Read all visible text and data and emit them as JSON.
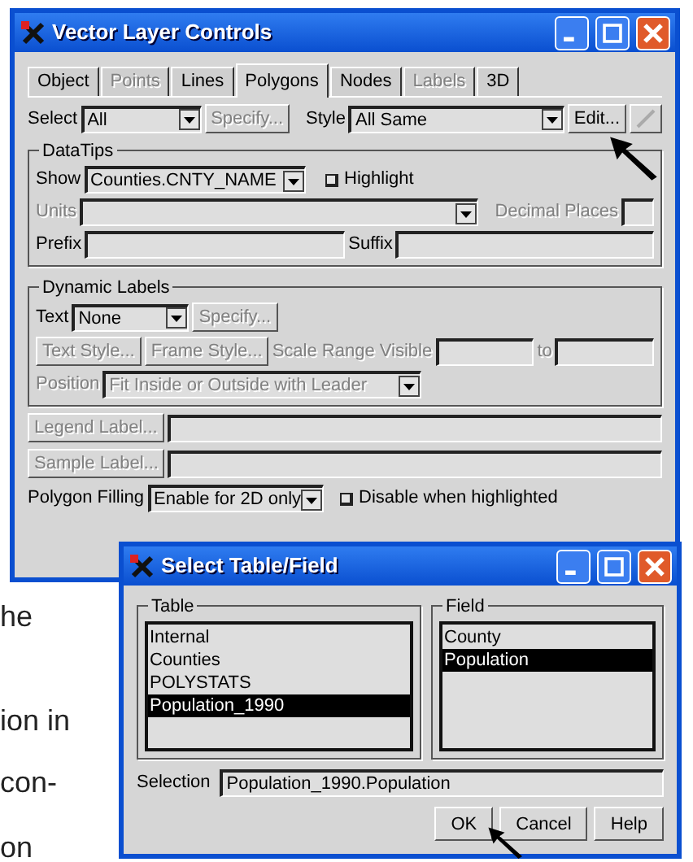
{
  "background_text": [
    "he",
    "ion in",
    "con-",
    "on"
  ],
  "main_window": {
    "title": "Vector Layer Controls",
    "tabs": [
      {
        "label": "Object",
        "selected": false,
        "disabled": false
      },
      {
        "label": "Points",
        "selected": false,
        "disabled": true
      },
      {
        "label": "Lines",
        "selected": false,
        "disabled": false
      },
      {
        "label": "Polygons",
        "selected": true,
        "disabled": false
      },
      {
        "label": "Nodes",
        "selected": false,
        "disabled": false
      },
      {
        "label": "Labels",
        "selected": false,
        "disabled": true
      },
      {
        "label": "3D",
        "selected": false,
        "disabled": false
      }
    ],
    "select": {
      "label": "Select",
      "value": "All",
      "button": {
        "label": "Specify...",
        "disabled": true
      }
    },
    "style": {
      "label": "Style",
      "value": "All Same",
      "button": {
        "label": "Edit...",
        "disabled": false
      }
    },
    "datatips": {
      "title": "DataTips",
      "show": {
        "label": "Show",
        "value": "Counties.CNTY_NAME"
      },
      "highlight": {
        "label": "Highlight",
        "checked": false
      },
      "units": {
        "label": "Units",
        "disabled": true
      },
      "decimal_places": {
        "label": "Decimal Places",
        "disabled": true
      },
      "prefix": {
        "label": "Prefix",
        "disabled": false
      },
      "suffix": {
        "label": "Suffix",
        "disabled": false
      }
    },
    "dynamic_labels": {
      "title": "Dynamic Labels",
      "text": {
        "label": "Text",
        "value": "None"
      },
      "specify_button": {
        "label": "Specify...",
        "disabled": true
      },
      "text_style_button": {
        "label": "Text Style...",
        "disabled": true
      },
      "frame_style_button": {
        "label": "Frame Style...",
        "disabled": true
      },
      "scale_range": {
        "label": "Scale Range Visible",
        "disabled": true
      },
      "to": {
        "label": "to",
        "disabled": true
      },
      "position": {
        "label": "Position",
        "value": "Fit Inside or Outside with Leader",
        "disabled": true
      }
    },
    "legend_label_button": {
      "label": "Legend Label...",
      "disabled": true
    },
    "sample_label_button": {
      "label": "Sample Label...",
      "disabled": true
    },
    "polygon_filling": {
      "label": "Polygon Filling",
      "value": "Enable for 2D only",
      "disable_when_highlighted": {
        "label": "Disable when highlighted",
        "checked": false
      }
    }
  },
  "dialog": {
    "title": "Select Table/Field",
    "table": {
      "title": "Table",
      "items": [
        {
          "label": "Internal",
          "selected": false
        },
        {
          "label": "Counties",
          "selected": false
        },
        {
          "label": "POLYSTATS",
          "selected": false
        },
        {
          "label": "Population_1990",
          "selected": true
        }
      ]
    },
    "field": {
      "title": "Field",
      "items": [
        {
          "label": "County",
          "selected": false
        },
        {
          "label": "Population",
          "selected": true
        }
      ]
    },
    "selection": {
      "label": "Selection",
      "value": "Population_1990.Population"
    },
    "buttons": [
      {
        "label": "OK"
      },
      {
        "label": "Cancel"
      },
      {
        "label": "Help"
      }
    ]
  }
}
